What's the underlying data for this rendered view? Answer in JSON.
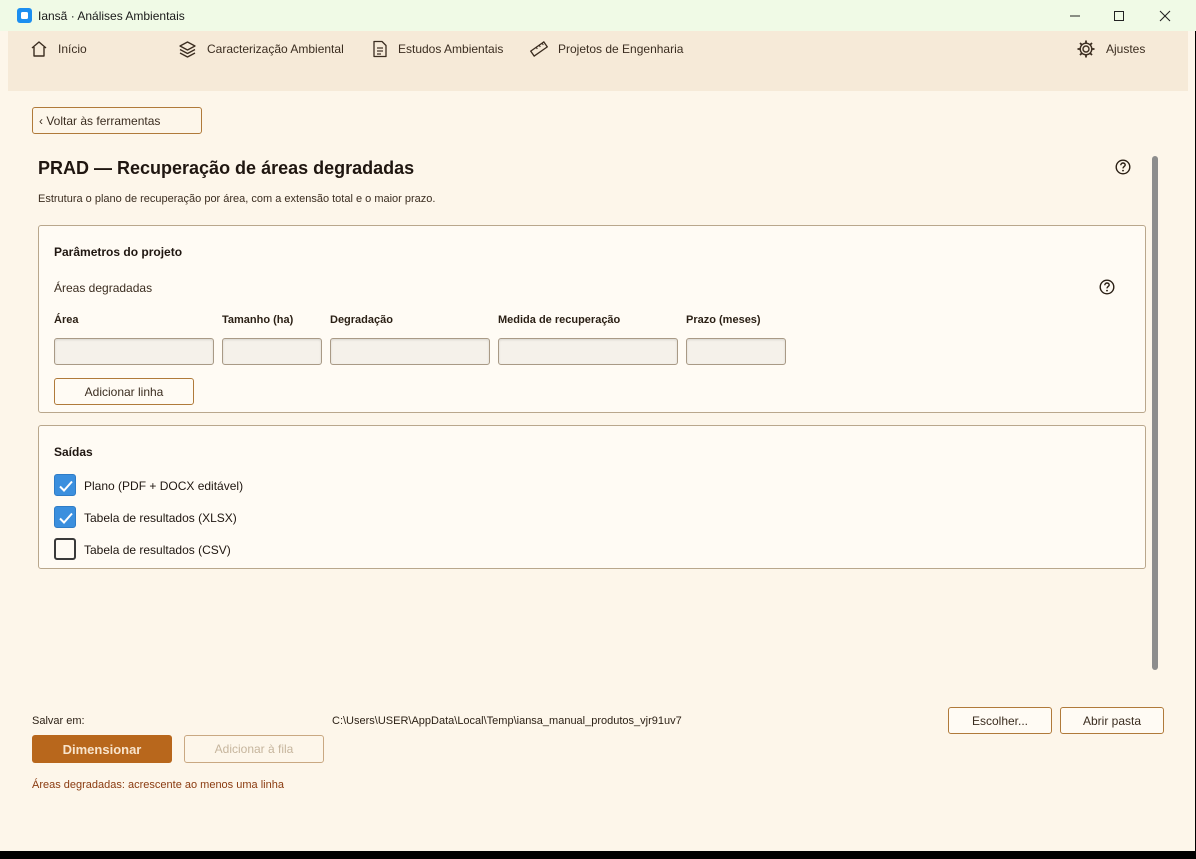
{
  "window": {
    "title": "Iansã · Análises Ambientais"
  },
  "nav": {
    "items": [
      {
        "label": "Início",
        "icon": "home-icon"
      },
      {
        "label": "Caracterização Ambiental",
        "icon": "layers-icon"
      },
      {
        "label": "Estudos Ambientais",
        "icon": "document-icon"
      },
      {
        "label": "Projetos de Engenharia",
        "icon": "ruler-icon"
      }
    ],
    "settings": {
      "label": "Ajustes",
      "icon": "gear-icon"
    }
  },
  "back_button": "‹ Voltar às ferramentas",
  "page": {
    "title": "PRAD — Recuperação de áreas degradadas",
    "subtitle": "Estrutura o plano de recuperação por área, com a extensão total e o maior prazo."
  },
  "params": {
    "title": "Parâmetros do projeto",
    "table_label": "Áreas degradadas",
    "columns": [
      "Área",
      "Tamanho (ha)",
      "Degradação",
      "Medida de recuperação",
      "Prazo (meses)"
    ],
    "values": [
      "",
      "",
      "",
      "",
      ""
    ],
    "add_row": "Adicionar linha"
  },
  "outputs": {
    "title": "Saídas",
    "options": [
      {
        "label": "Plano (PDF + DOCX editável)",
        "checked": true
      },
      {
        "label": "Tabela de resultados (XLSX)",
        "checked": true
      },
      {
        "label": "Tabela de resultados (CSV)",
        "checked": false
      }
    ]
  },
  "footer": {
    "save_label": "Salvar em:",
    "save_path": "C:\\Users\\USER\\AppData\\Local\\Temp\\iansa_manual_produtos_vjr91uv7",
    "choose": "Escolher...",
    "open_folder": "Abrir pasta",
    "primary": "Dimensionar",
    "queue": "Adicionar à fila",
    "error": "Áreas degradadas: acrescente ao menos uma linha"
  },
  "colors": {
    "accent": "#b8671c",
    "background": "#fdf6ea",
    "nav_bg": "#f6ead8",
    "check_blue": "#3b8fde",
    "error": "#8a3b10"
  }
}
